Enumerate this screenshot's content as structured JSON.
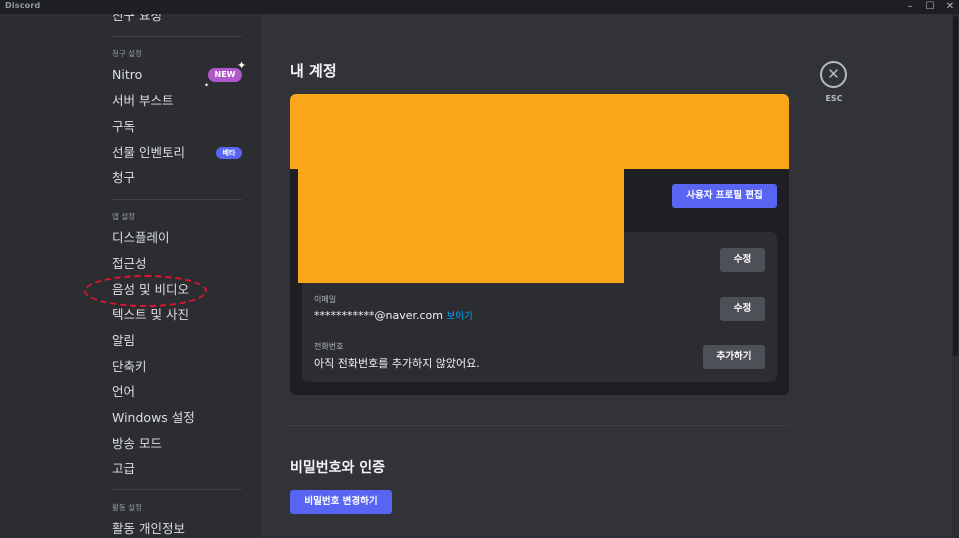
{
  "window": {
    "app_name": "Discord",
    "controls": {
      "minimize": "–",
      "maximize": "☐",
      "close": "✕"
    }
  },
  "sidebar": {
    "items_top": [
      {
        "label": "친구 요청"
      }
    ],
    "billing": {
      "category": "청구 설정",
      "items": [
        {
          "label": "Nitro",
          "badge": "NEW"
        },
        {
          "label": "서버 부스트"
        },
        {
          "label": "구독"
        },
        {
          "label": "선물 인벤토리",
          "badge": "베타"
        },
        {
          "label": "청구"
        }
      ]
    },
    "app": {
      "category": "앱 설정",
      "items": [
        {
          "label": "디스플레이"
        },
        {
          "label": "접근성"
        },
        {
          "label": "음성 및 비디오"
        },
        {
          "label": "텍스트 및 사진"
        },
        {
          "label": "알림"
        },
        {
          "label": "단축키"
        },
        {
          "label": "언어"
        },
        {
          "label": "Windows 설정"
        },
        {
          "label": "방송 모드"
        },
        {
          "label": "고급"
        }
      ]
    },
    "activity": {
      "category": "활동 설정",
      "items": [
        {
          "label": "활동 개인정보"
        }
      ]
    }
  },
  "main": {
    "title": "내 계정",
    "close_icon": "✕",
    "close_label": "ESC",
    "edit_profile_button": "사용자 프로필 편집",
    "fields": {
      "username": {
        "edit_button": "수정"
      },
      "email": {
        "label": "이메일",
        "value": "***********@naver.com",
        "reveal_link": "보이기",
        "edit_button": "수정"
      },
      "phone": {
        "label": "전화번호",
        "value": "아직 전화번호를 추가하지 않았어요.",
        "add_button": "추가하기"
      }
    },
    "password_section": {
      "title": "비밀번호와 인증",
      "change_button": "비밀번호 변경하기"
    }
  },
  "colors": {
    "background": "#313338",
    "sidebar": "#2b2d31",
    "card": "#1e1f22",
    "brand": "#5865f2",
    "banner": "#faa61a",
    "redaction": "#faa61a",
    "link": "#00a8fc",
    "highlight": "#e0142e",
    "new_badge": "#b057c9"
  }
}
